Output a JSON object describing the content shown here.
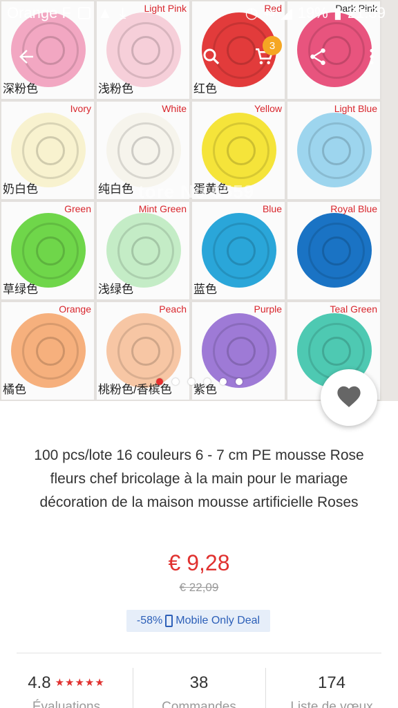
{
  "status_bar": {
    "carrier": "Orange F",
    "network": "4G",
    "battery": "19%",
    "time": "21:39"
  },
  "toolbar": {
    "back_icon": "arrow-back-icon",
    "search_icon": "search-icon",
    "cart_icon": "cart-icon",
    "cart_count": "3",
    "share_icon": "share-icon",
    "more_icon": "more-vertical-icon"
  },
  "gallery": {
    "watermark": "tore No 6559",
    "swatches": [
      {
        "name": "",
        "cn": "深粉色",
        "color": "#f2a7c2"
      },
      {
        "name": "Light Pink",
        "cn": "浅粉色",
        "color": "#f6cfd9"
      },
      {
        "name": "Red",
        "cn": "红色",
        "color": "#e23b3b"
      },
      {
        "name": "Dark Pink",
        "cn": "",
        "color": "#e8547e"
      },
      {
        "name": "Ivory",
        "cn": "奶白色",
        "color": "#f8f2cf"
      },
      {
        "name": "White",
        "cn": "纯白色",
        "color": "#f6f4ec"
      },
      {
        "name": "Yellow",
        "cn": "蛋黄色",
        "color": "#f5e43a"
      },
      {
        "name": "Light Blue",
        "cn": "",
        "color": "#9dd5ee"
      },
      {
        "name": "Green",
        "cn": "草绿色",
        "color": "#6fd64a"
      },
      {
        "name": "Mint Green",
        "cn": "浅绿色",
        "color": "#c4ecc6"
      },
      {
        "name": "Blue",
        "cn": "蓝色",
        "color": "#2aa6d9"
      },
      {
        "name": "Royal Blue",
        "cn": "",
        "color": "#1a73c4"
      },
      {
        "name": "Orange",
        "cn": "橘色",
        "color": "#f6b07d"
      },
      {
        "name": "Peach",
        "cn": "桃粉色/香槟色",
        "color": "#f7c6a4"
      },
      {
        "name": "Purple",
        "cn": "紫色",
        "color": "#9e7ad6"
      },
      {
        "name": "Teal Green",
        "cn": "",
        "color": "#4ec9b2"
      }
    ],
    "pagination": {
      "count": 6,
      "active": 0
    }
  },
  "wishlist": {
    "icon": "heart-icon"
  },
  "product": {
    "title": "100 pcs/lote 16 couleurs 6 - 7 cm PE mousse Rose fleurs chef bricolage à la main pour le mariage décoration de la maison mousse artificielle Roses",
    "price": "€ 9,28",
    "old_price": "€ 22,09",
    "deal_discount": "-58%",
    "deal_label": "Mobile Only Deal"
  },
  "stats": [
    {
      "value": "4.8",
      "stars": "★★★★★",
      "label": "Évaluations"
    },
    {
      "value": "38",
      "label": "Commandes"
    },
    {
      "value": "174",
      "label": "Liste de vœux"
    }
  ],
  "colors": {
    "accent_red": "#e0312f",
    "cart_badge": "#f5a623",
    "deal_blue": "#2c5fb8"
  }
}
